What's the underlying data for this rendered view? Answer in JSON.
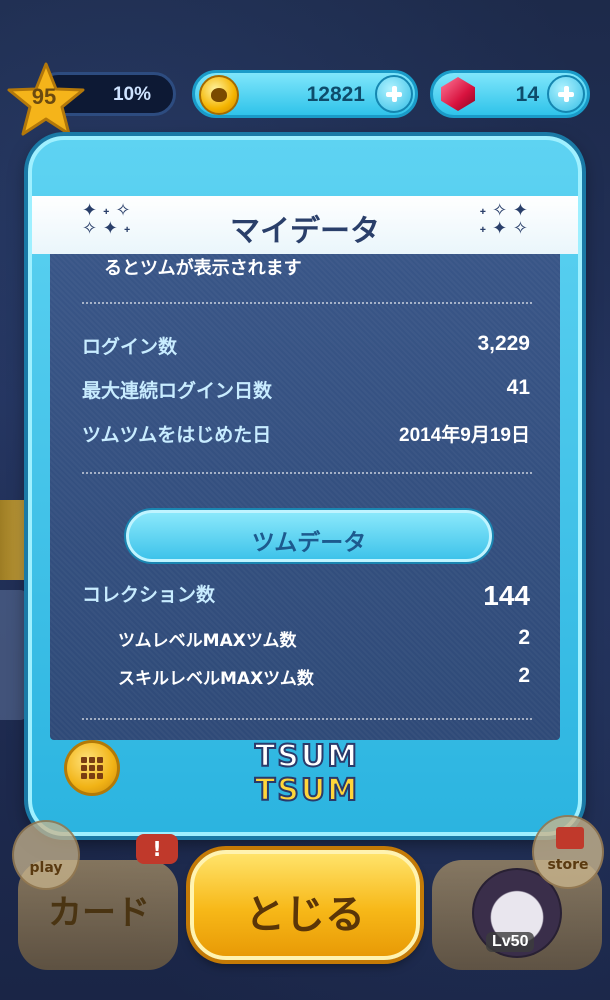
{
  "topbar": {
    "level": "95",
    "level_progress": "10%",
    "coins": "12821",
    "gems": "14"
  },
  "modal": {
    "title": "マイデータ",
    "cut_text": "るとツムが表示されます",
    "stats": [
      {
        "label": "ログイン数",
        "value": "3,229"
      },
      {
        "label": "最大連続ログイン日数",
        "value": "41"
      },
      {
        "label": "ツムツムをはじめた日",
        "value": "2014年9月19日"
      }
    ],
    "section_title": "ツムデータ",
    "collection": {
      "label": "コレクション数",
      "value": "144"
    },
    "sub_stats": [
      {
        "label": "ツムレベルMAXツム数",
        "value": "2"
      },
      {
        "label": "スキルレベルMAXツム数",
        "value": "2"
      }
    ],
    "logo": {
      "line1": "TSUM",
      "line2": "TSUM"
    }
  },
  "bottom": {
    "card_label": "カード",
    "play_label": "play",
    "notice": "!",
    "close_label": "とじる",
    "store_label": "store",
    "avatar_level": "Lv50"
  },
  "icons": {
    "star": "star-icon",
    "coin": "coin-icon",
    "gem": "gem-icon",
    "plus": "plus-icon",
    "menu": "grid-menu-icon",
    "sparkle": "sparkle-icon"
  }
}
